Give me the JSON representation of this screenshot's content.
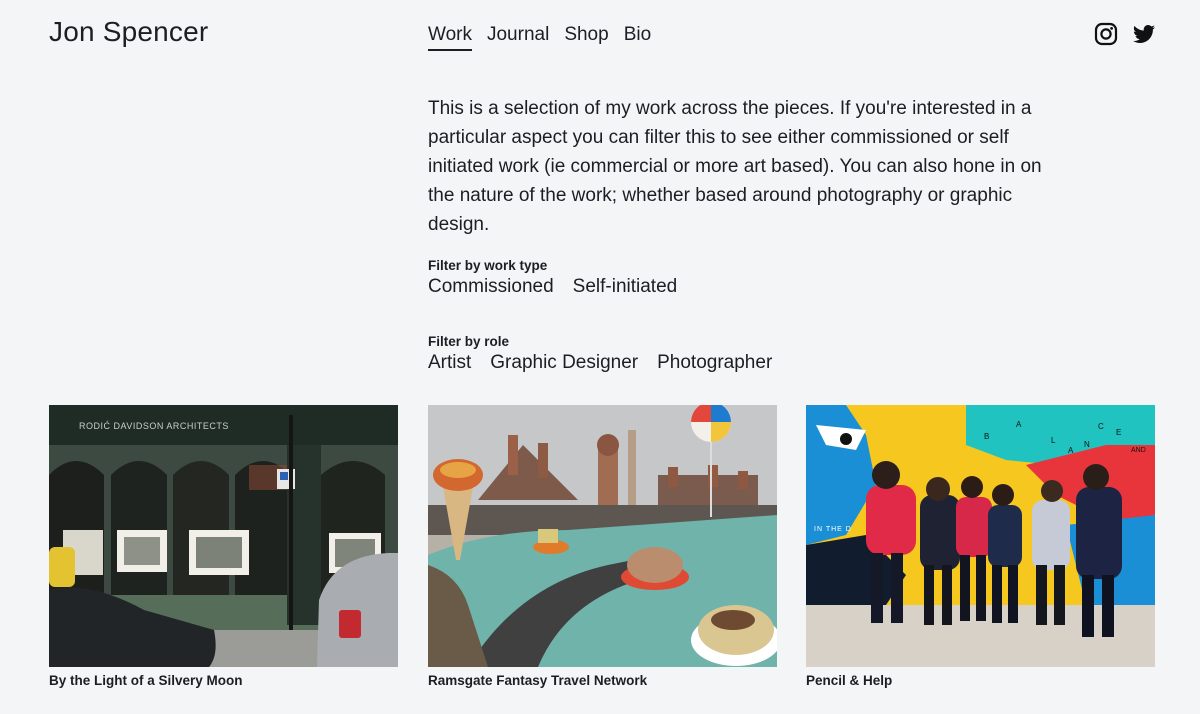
{
  "site": {
    "title": "Jon Spencer"
  },
  "nav": {
    "items": [
      {
        "label": "Work",
        "active": true
      },
      {
        "label": "Journal",
        "active": false
      },
      {
        "label": "Shop",
        "active": false
      },
      {
        "label": "Bio",
        "active": false
      }
    ]
  },
  "social": {
    "icons": [
      "instagram-icon",
      "twitter-icon"
    ]
  },
  "intro": {
    "text": "This is a selection of my work across the pieces. If you're interested in a particular aspect you can filter this to see either commissioned or self initiated work (ie commercial or more art based). You can also hone in on the nature of the work; whether based around photography or graphic design."
  },
  "filters": {
    "work_type": {
      "label": "Filter by work type",
      "options": [
        "Commissioned",
        "Self-initiated"
      ]
    },
    "role": {
      "label": "Filter by role",
      "options": [
        "Artist",
        "Graphic Designer",
        "Photographer"
      ]
    }
  },
  "projects": [
    {
      "caption": "By the Light of a Silvery Moon",
      "sign_text": "RODIĆ DAVIDSON ARCHITECTS"
    },
    {
      "caption": "Ramsgate Fantasy Travel Network"
    },
    {
      "caption": "Pencil & Help",
      "mural_letters": [
        "B",
        "A",
        "L",
        "A",
        "N",
        "C",
        "E",
        "AND",
        "IN THE D"
      ]
    }
  ],
  "colors": {
    "background": "#f4f5f7",
    "text": "#1d1d24",
    "mural_yellow": "#f5c71f",
    "mural_blue": "#1a8fd6",
    "mural_red": "#e8353c",
    "mural_teal": "#20c3c0"
  }
}
